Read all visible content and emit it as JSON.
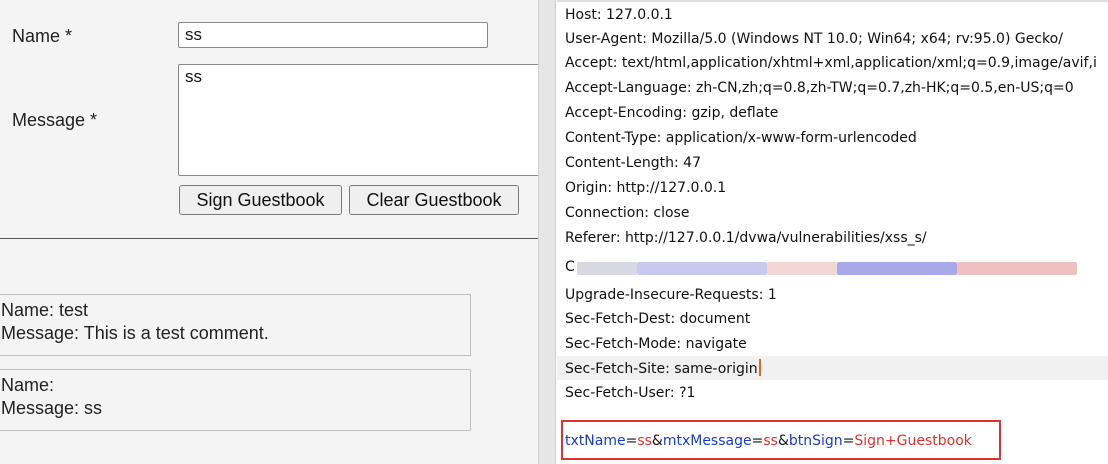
{
  "form": {
    "name_label": "Name *",
    "name_value": "ss",
    "message_label": "Message *",
    "message_value": "ss",
    "sign_label": "Sign Guestbook",
    "clear_label": "Clear Guestbook"
  },
  "entries": [
    {
      "name": "Name: test",
      "message": "Message: This is a test comment."
    },
    {
      "name": "Name:",
      "message": "Message: ss"
    }
  ],
  "request": {
    "headers": [
      "Host: 127.0.0.1",
      "User-Agent: Mozilla/5.0 (Windows NT 10.0; Win64; x64; rv:95.0) Gecko/",
      "Accept: text/html,application/xhtml+xml,application/xml;q=0.9,image/avif,i",
      "Accept-Language: zh-CN,zh;q=0.8,zh-TW;q=0.7,zh-HK;q=0.5,en-US;q=0",
      "Accept-Encoding: gzip, deflate",
      "Content-Type: application/x-www-form-urlencoded",
      "Content-Length: 47",
      "Origin: http://127.0.0.1",
      "Connection: close",
      "Referer: http://127.0.0.1/dvwa/vulnerabilities/xss_s/",
      "C",
      "Upgrade-Insecure-Requests: 1",
      "Sec-Fetch-Dest: document",
      "Sec-Fetch-Mode: navigate",
      "Sec-Fetch-Site: same-origin",
      "Sec-Fetch-User: ?1"
    ],
    "body": {
      "k1": "txtName",
      "v1": "ss",
      "k2": "mtxMessage",
      "v2": "ss",
      "k3": "btnSign",
      "v3": "Sign+Guestbook"
    }
  },
  "colors": {
    "param_key": "#1a3cc7",
    "param_value": "#e0312d",
    "highlight_box": "#e03030",
    "cursor": "#e8622a"
  }
}
